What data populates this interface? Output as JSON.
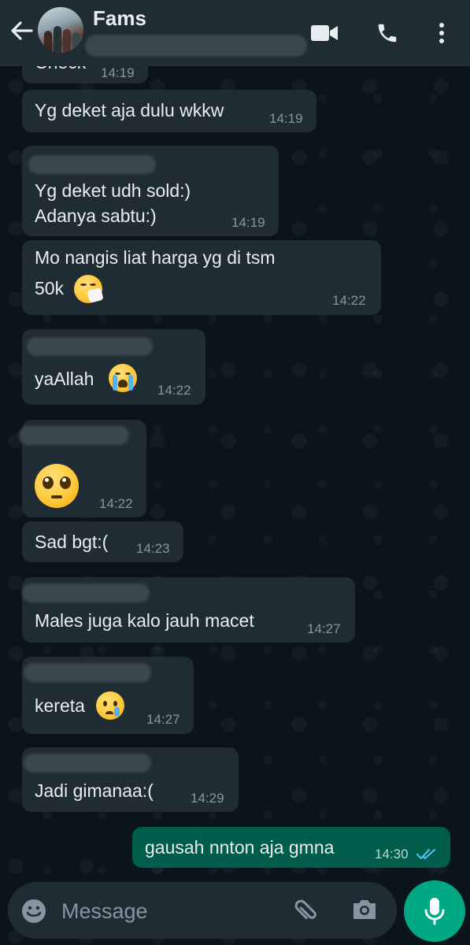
{
  "header": {
    "title": "Fams",
    "icons": [
      "back-arrow-icon",
      "video-call-icon",
      "voice-call-icon",
      "more-options-icon"
    ]
  },
  "messages": [
    {
      "text": "Check",
      "time": "14:19"
    },
    {
      "text": "Yg deket aja dulu wkkw",
      "time": "14:19"
    },
    {
      "line1": "Yg deket udh sold:)",
      "line2": "Adanya sabtu:)",
      "time": "14:19"
    },
    {
      "line1": "Mo nangis liat harga yg di tsm",
      "line2": "50k",
      "time": "14:22"
    },
    {
      "text": "yaAllah",
      "time": "14:22"
    },
    {
      "time": "14:22"
    },
    {
      "text": "Sad bgt:(",
      "time": "14:23"
    },
    {
      "text": "Males juga kalo jauh macet",
      "time": "14:27"
    },
    {
      "text": "kereta",
      "time": "14:27"
    },
    {
      "text": "Jadi gimanaa:(",
      "time": "14:29"
    },
    {
      "text": "gausah nnton aja gmna",
      "time": "14:30",
      "status": "read-double-check-icon"
    }
  ],
  "composer": {
    "placeholder": "Message",
    "icons": [
      "emoji-icon",
      "attach-icon",
      "camera-icon",
      "mic-icon"
    ]
  },
  "colors": {
    "background": "#0b141a",
    "incoming_bubble": "#202c33",
    "outgoing_bubble": "#005c4b",
    "accent": "#00a884",
    "read_ticks": "#53bdeb"
  }
}
